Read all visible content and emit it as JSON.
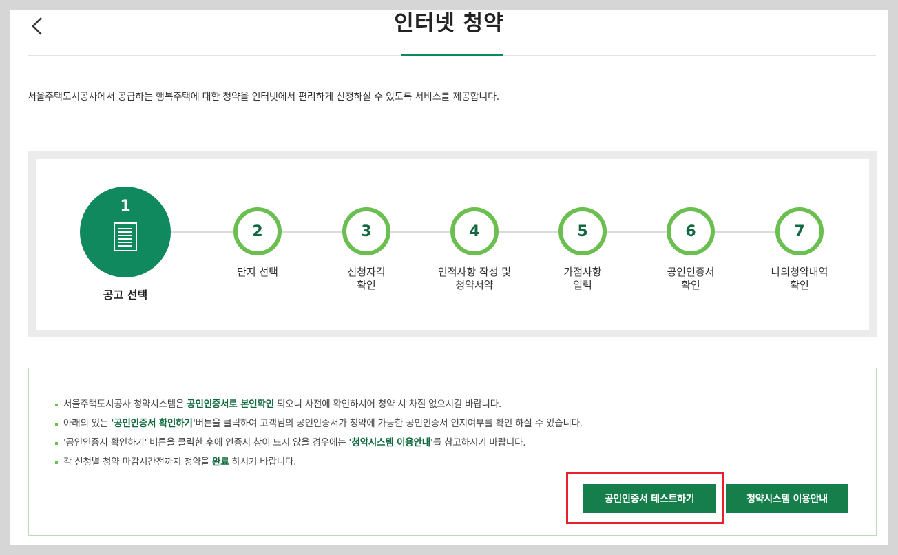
{
  "header": {
    "title": "인터넷 청약"
  },
  "intro": "서울주택도시공사에서 공급하는 행복주택에 대한 청약을 인터넷에서 편리하게 신청하실 수 있도록 서비스를 제공합니다.",
  "steps": [
    {
      "number": "1",
      "label": "공고 선택",
      "icon": "document-icon",
      "active": true
    },
    {
      "number": "2",
      "label": "단지 선택"
    },
    {
      "number": "3",
      "label_line1": "신청자격",
      "label_line2": "확인"
    },
    {
      "number": "4",
      "label_line1": "인적사항 작성 및",
      "label_line2": "청약서약"
    },
    {
      "number": "5",
      "label_line1": "가점사항",
      "label_line2": "입력"
    },
    {
      "number": "6",
      "label_line1": "공인인증서",
      "label_line2": "확인"
    },
    {
      "number": "7",
      "label_line1": "나의청약내역",
      "label_line2": "확인"
    }
  ],
  "notice": {
    "item1": {
      "pre": "서울주택도시공사 청약시스템은 ",
      "em": "공인인증서로 본인확인",
      "post": " 되오니 사전에 확인하시어 청약 시 차질 없으시길 바랍니다."
    },
    "item2": {
      "em": "'공인인증서 확인하기'",
      "post": "버튼을 클릭하여 고객님의 공인인증서가 청약에 가능한 공인인증서 인지여부를 확인 하실 수 있습니다.",
      "pre": "아래의 있는 "
    },
    "item3": {
      "pre": "'공인인증서 확인하기' 버튼을 클릭한 후에 인증서 창이 뜨지 않을 경우에는 ",
      "em": "'청약시스템 이용안내'",
      "post": "를 참고하시기 바랍니다."
    },
    "item4": {
      "pre": "각 신청별 청약 마감시간전까지 청약을 ",
      "em": "완료",
      "post": " 하시기 바랍니다."
    }
  },
  "buttons": {
    "cert_test": "공인인증서 테스트하기",
    "guide": "청약시스템 이용안내"
  },
  "colors": {
    "primary_green": "#10895e",
    "ring_green": "#6bbf50",
    "button_green": "#157e4a",
    "highlight_red": "#e8202a"
  }
}
